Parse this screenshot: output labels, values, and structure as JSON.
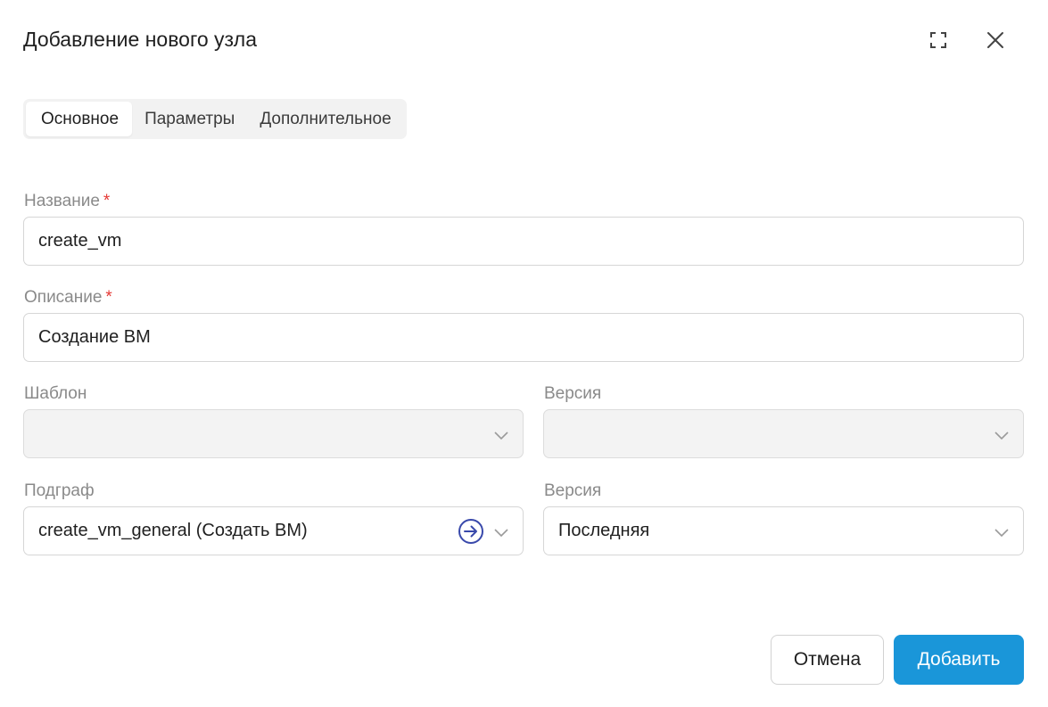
{
  "dialog": {
    "title": "Добавление нового узла"
  },
  "tabs": [
    {
      "label": "Основное",
      "active": true
    },
    {
      "label": "Параметры",
      "active": false
    },
    {
      "label": "Дополнительное",
      "active": false
    }
  ],
  "form": {
    "name": {
      "label": "Название",
      "required_mark": "*",
      "value": "create_vm"
    },
    "description": {
      "label": "Описание",
      "required_mark": "*",
      "value": "Создание ВМ"
    },
    "template": {
      "label": "Шаблон",
      "value": "",
      "disabled": true
    },
    "template_version": {
      "label": "Версия",
      "value": "",
      "disabled": true
    },
    "subgraph": {
      "label": "Подграф",
      "value": "create_vm_general (Создать ВМ)"
    },
    "subgraph_version": {
      "label": "Версия",
      "value": "Последняя"
    }
  },
  "buttons": {
    "cancel": "Отмена",
    "add": "Добавить"
  },
  "icons": {
    "maximize": "maximize-icon",
    "close": "close-icon",
    "chevron": "chevron-down-icon",
    "navigate": "arrow-right-circle-icon"
  },
  "colors": {
    "primary": "#1a96d9",
    "required": "#e53935",
    "navigate_icon": "#3949ab"
  }
}
